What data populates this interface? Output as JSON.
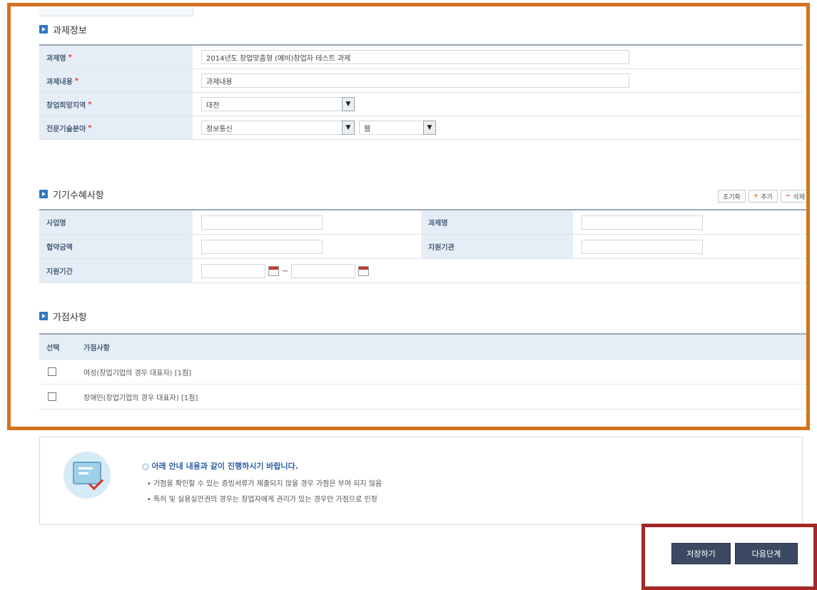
{
  "sections": {
    "task_info": {
      "title": "과제정보",
      "rows": [
        {
          "label": "과제명",
          "value": "2014년도 창업맞춤형 (예비)창업자 테스트 과제"
        },
        {
          "label": "과제내용",
          "value": "과제내용"
        },
        {
          "label": "창업희망지역",
          "value": "대전"
        },
        {
          "label": "전문기술분야",
          "value": "정보통신",
          "value2": "웹"
        }
      ]
    },
    "prior_support": {
      "title": "기기수혜사항",
      "buttons": {
        "reset": "초기화",
        "add": "추가",
        "remove": "삭제"
      },
      "labels": {
        "business_name": "사업명",
        "task_name": "과제명",
        "agreement_amount": "협약금액",
        "support_agency": "지원기관",
        "support_period": "지원기간"
      },
      "date_separator": "~"
    },
    "bonus": {
      "title": "가점사항",
      "headers": {
        "select": "선택",
        "item": "가점사항"
      },
      "items": [
        {
          "label": "여성(창업기업의 경우 대표자) [1점]"
        },
        {
          "label": "장애인(창업기업의 경우 대표자) [1점]"
        }
      ]
    }
  },
  "notice": {
    "title": "아래 안내 내용과 같이 진행하시기 바랍니다.",
    "lines": [
      "가점을 확인할 수 있는 증빙서류가 제출되지 않을 경우 가점은 부여 되지 않음",
      "특허 및 실용실안권의 경우는 창업자에게 권리가 있는 경우만 가점으로 인정"
    ]
  },
  "actions": {
    "save": "저장하기",
    "next": "다음단계"
  },
  "colors": {
    "highlight_orange": "#d3731f",
    "highlight_red": "#a42828",
    "header_bg": "#e5eef6",
    "button_bg": "#3b4a62"
  }
}
